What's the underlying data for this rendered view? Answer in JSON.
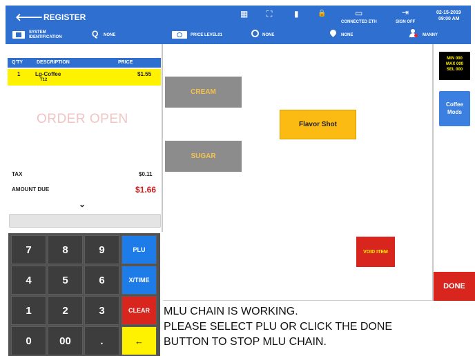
{
  "header": {
    "back_glyph": "🡐",
    "title": "REGISTER",
    "date": "02-15-2019",
    "time": "09:00 AM",
    "icons": [
      "grid-icon",
      "table-icon",
      "printer-icon",
      "lock-icon",
      "computer-icon",
      "sign-off-icon"
    ],
    "glyphs": {
      "grid": "▦",
      "table": "⛶",
      "printer": "▮",
      "lock": "🔒",
      "computer": "▭",
      "sign_off": "⇥"
    },
    "connected_label": "CONNECTED ETH",
    "sign_off_label": "SIGN OFF",
    "row2": {
      "system_id": "SYSTEM\nIDENTIFICATION",
      "search_glyph": "Q",
      "search_value": "NONE",
      "price_level": "PRICE LEVEL01",
      "timer_value": "NONE",
      "location_value": "NONE",
      "user": "MANNY"
    }
  },
  "order": {
    "columns": [
      "Q'TY",
      "DESCRIPTION",
      "PRICE"
    ],
    "items": [
      {
        "qty": "1",
        "description": "Lg-Coffee",
        "sub": "T12",
        "price": "$1.55"
      }
    ],
    "status": "ORDER OPEN",
    "tax_label": "TAX",
    "tax_value": "$0.11",
    "due_label": "AMOUNT DUE",
    "due_value": "$1.66",
    "chevron": "⌄"
  },
  "keypad": {
    "keys": [
      "7",
      "8",
      "9",
      "PLU",
      "4",
      "5",
      "6",
      "X/TIME",
      "1",
      "2",
      "3",
      "CLEAR",
      "0",
      "00",
      ".",
      "←"
    ]
  },
  "modifiers": {
    "cream": "CREAM",
    "sugar": "SUGAR",
    "flavor_shot": "Flavor Shot",
    "void_item": "VOID ITEM"
  },
  "right_panel": {
    "min": "MIN 000",
    "max": "MAX 000",
    "sel": "SEL 000",
    "coffee_mods_line1": "Coffee",
    "coffee_mods_line2": "Mods",
    "done": "DONE"
  },
  "message": {
    "line1": "MLU CHAIN IS WORKING.",
    "line2": "PLEASE SELECT PLU OR CLICK THE DONE",
    "line3": "BUTTON TO STOP MLU CHAIN."
  },
  "colors": {
    "header_blue": "#2f6fd0",
    "key_blue": "#1e7ce8",
    "clear_red": "#d8261f",
    "highlight_yellow": "#fff200",
    "flavor_gold": "#fcbb12"
  }
}
